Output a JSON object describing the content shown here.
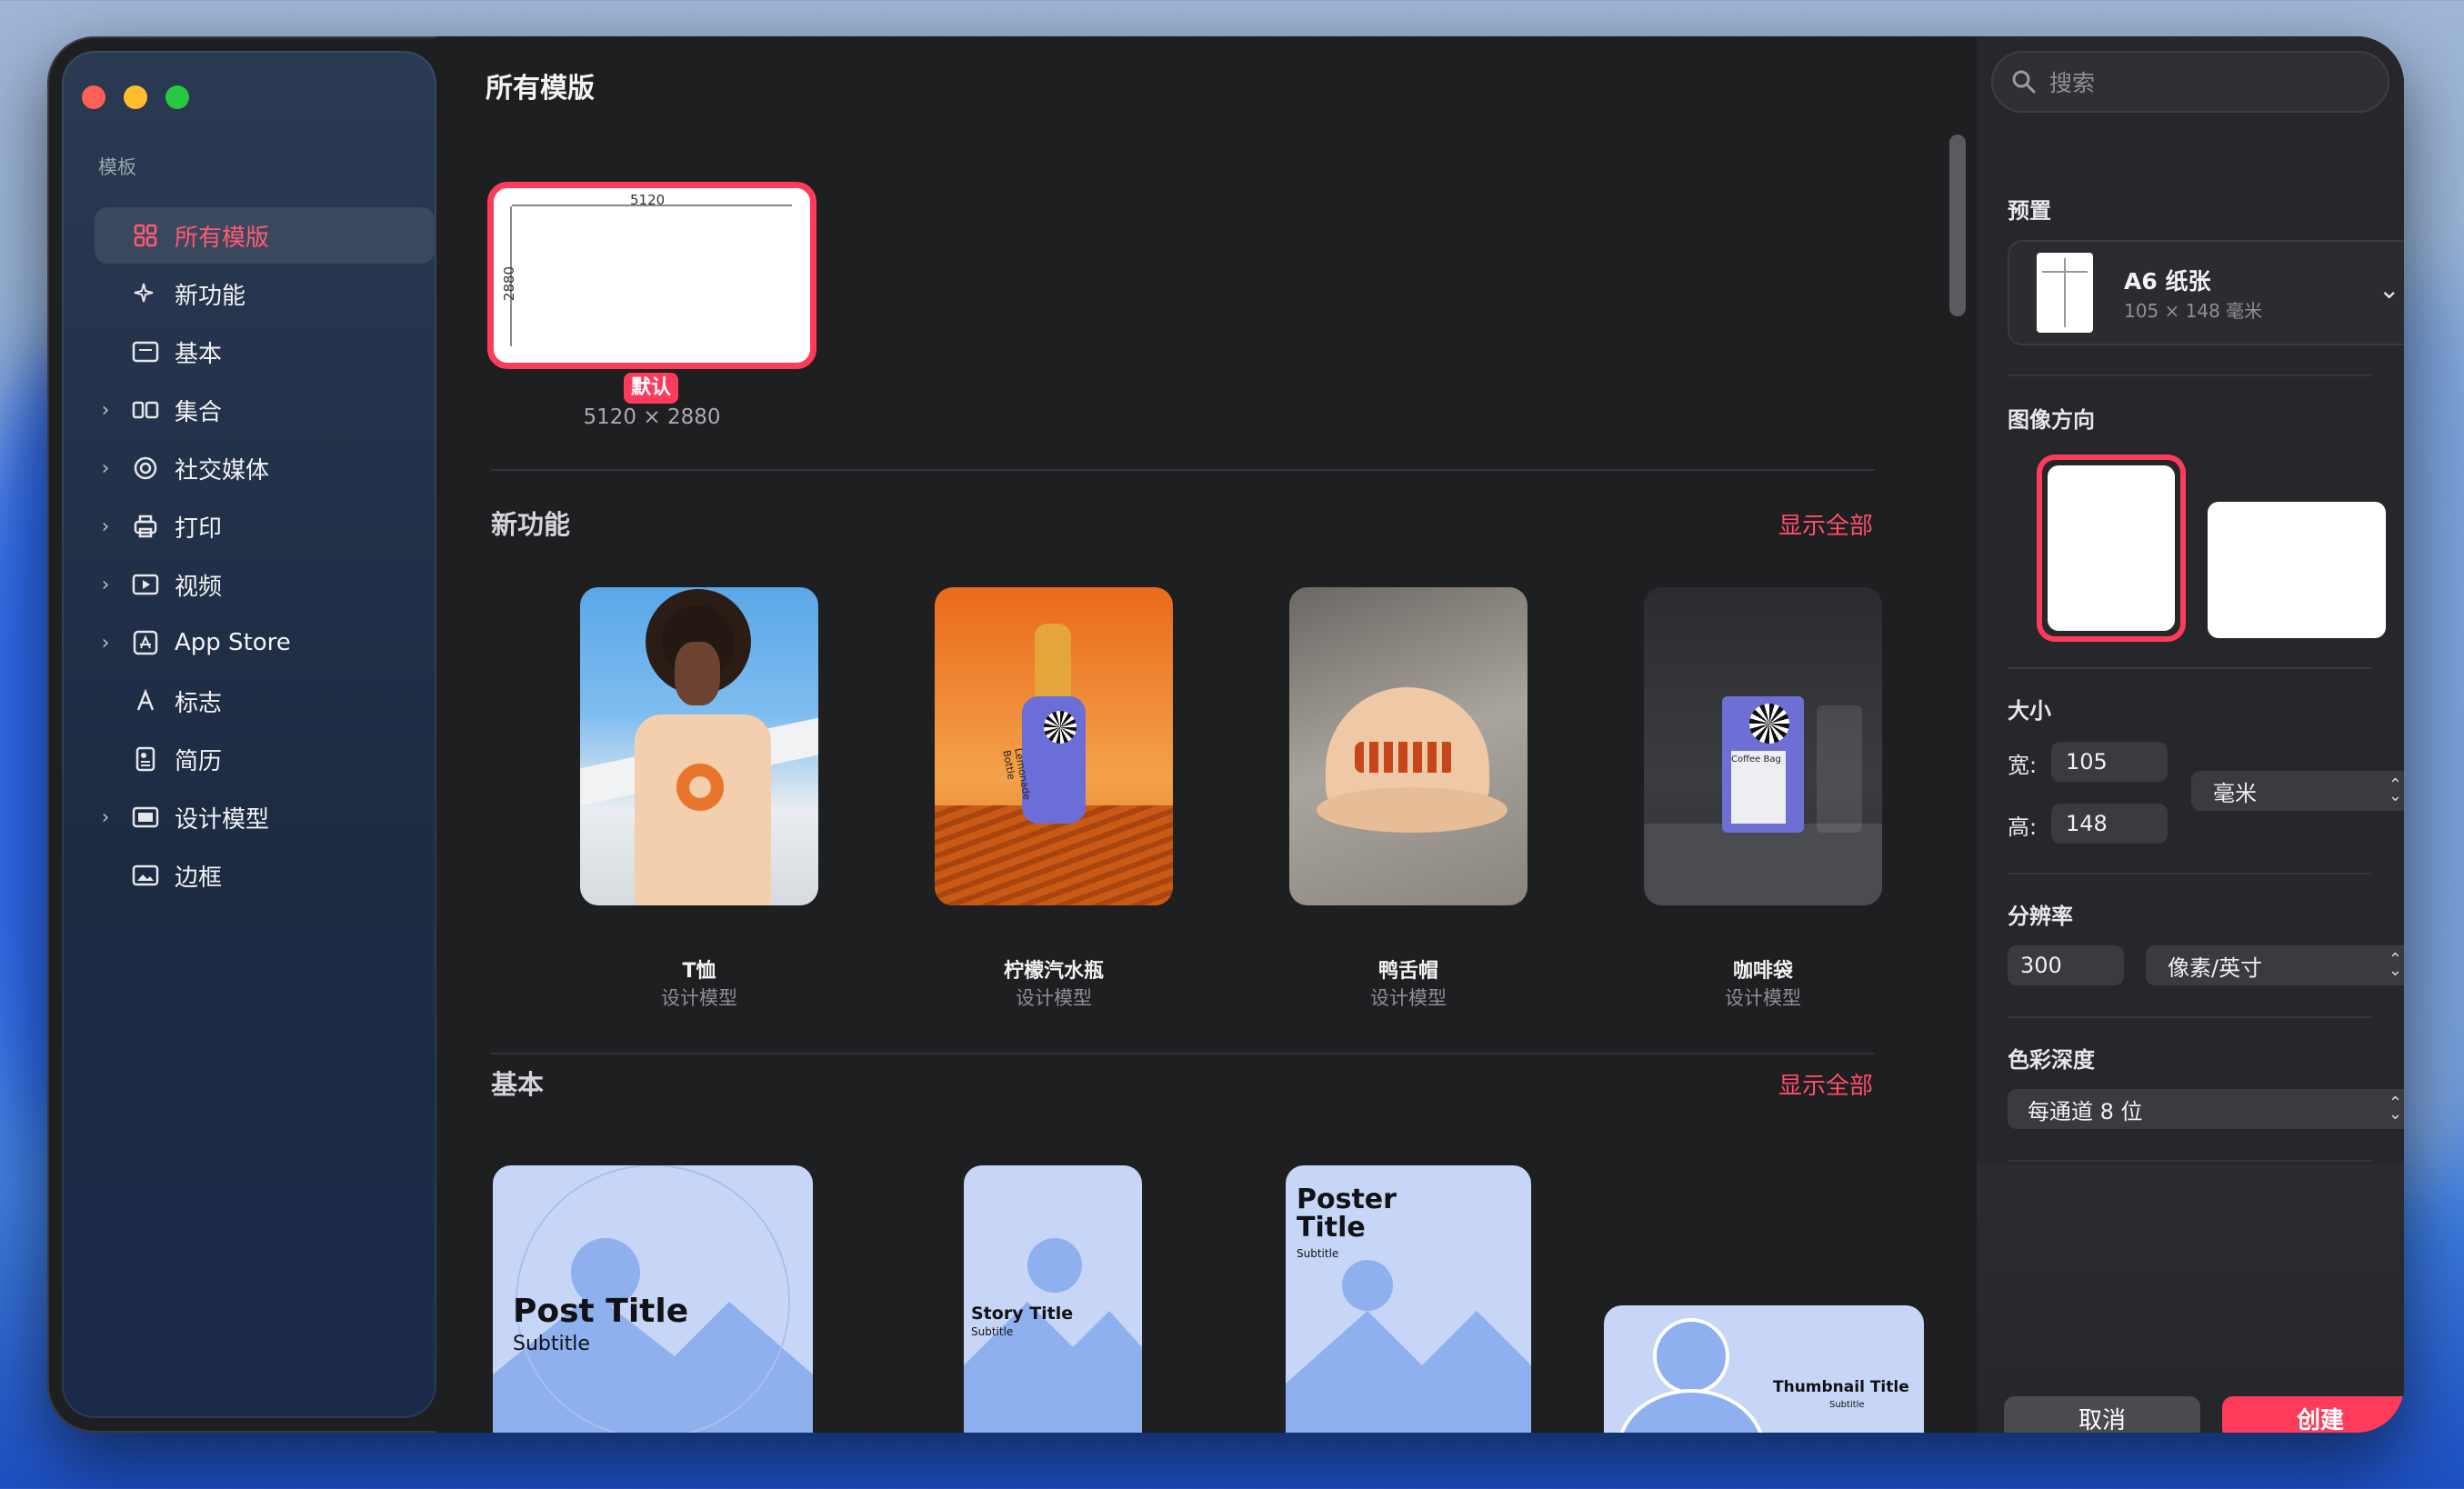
{
  "colors": {
    "accent": "#ff3b5c",
    "accent_text": "#ff5a73",
    "thumb_blue": "#c7d6f6",
    "thumb_shape": "#8fb0ee"
  },
  "sidebar": {
    "section": "模板",
    "items": [
      {
        "label": "所有模版",
        "icon": "grid-icon",
        "chevron": false,
        "active": true
      },
      {
        "label": "新功能",
        "icon": "sparkle-icon",
        "chevron": false
      },
      {
        "label": "基本",
        "icon": "document-icon",
        "chevron": false
      },
      {
        "label": "集合",
        "icon": "collection-icon",
        "chevron": true
      },
      {
        "label": "社交媒体",
        "icon": "at-icon",
        "chevron": true
      },
      {
        "label": "打印",
        "icon": "printer-icon",
        "chevron": true
      },
      {
        "label": "视频",
        "icon": "video-icon",
        "chevron": true
      },
      {
        "label": "App Store",
        "icon": "appstore-icon",
        "chevron": true
      },
      {
        "label": "标志",
        "icon": "letter-a-icon",
        "chevron": false
      },
      {
        "label": "简历",
        "icon": "resume-icon",
        "chevron": false
      },
      {
        "label": "设计模型",
        "icon": "mockup-icon",
        "chevron": true
      },
      {
        "label": "边框",
        "icon": "frame-icon",
        "chevron": false
      }
    ]
  },
  "main": {
    "title": "所有模版",
    "default_card": {
      "width_label": "5120",
      "height_label": "2880",
      "badge": "默认",
      "size": "5120 × 2880"
    },
    "sections": [
      {
        "title": "新功能",
        "show_all": "显示全部",
        "cards": [
          {
            "title": "T恤",
            "subtitle": "设计模型"
          },
          {
            "title": "柠檬汽水瓶",
            "subtitle": "设计模型"
          },
          {
            "title": "鸭舌帽",
            "subtitle": "设计模型"
          },
          {
            "title": "咖啡袋",
            "subtitle": "设计模型"
          }
        ]
      },
      {
        "title": "基本",
        "show_all": "显示全部",
        "cards": [
          {
            "title": "Post Title",
            "subtitle": "Subtitle"
          },
          {
            "title": "Story Title",
            "subtitle": "Subtitle"
          },
          {
            "title": "Poster Title",
            "subtitle": "Subtitle"
          },
          {
            "title": "Thumbnail Title",
            "subtitle": "Subtitle"
          }
        ]
      }
    ],
    "product_text": {
      "bottle": "Lemonade Bottle",
      "bag": "Coffee Bag"
    }
  },
  "panel": {
    "search_placeholder": "搜索",
    "preset_label": "预置",
    "preset_name": "A6 纸张",
    "preset_size": "105 × 148 毫米",
    "orientation_label": "图像方向",
    "size_label": "大小",
    "width_label": "宽:",
    "width_value": "105",
    "height_label": "高:",
    "height_value": "148",
    "unit": "毫米",
    "resolution_label": "分辨率",
    "resolution_value": "300",
    "resolution_unit": "像素/英寸",
    "depth_label": "色彩深度",
    "depth_value": "每通道 8 位",
    "cancel": "取消",
    "create": "创建"
  }
}
